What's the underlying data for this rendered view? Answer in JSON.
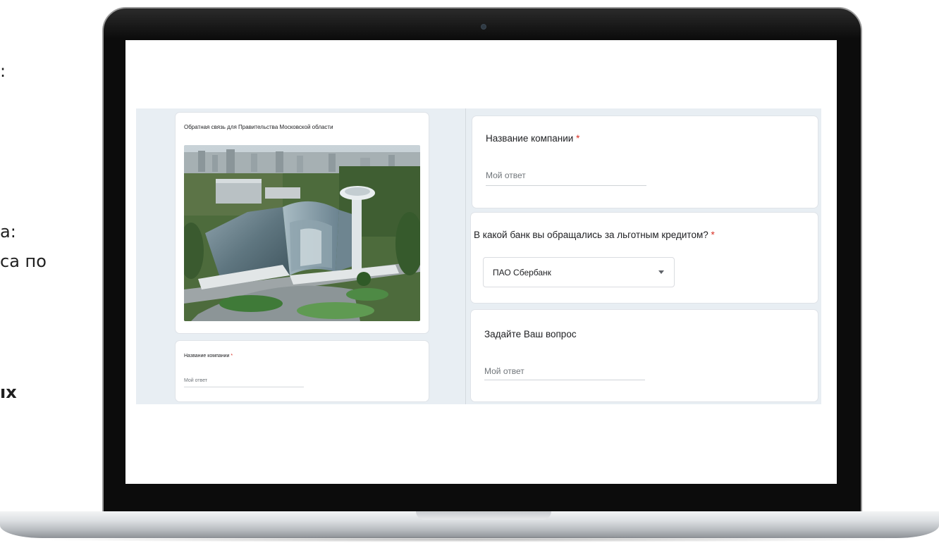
{
  "background_fragments": [
    {
      "text": ":"
    },
    {
      "text": "а:"
    },
    {
      "text": "са по"
    },
    {
      "text": "ıх"
    }
  ],
  "left_card": {
    "title": "Обратная связь для Правительства Московской области"
  },
  "left_question": {
    "label": "Название компании",
    "required_mark": "*",
    "answer_placeholder": "Мой ответ"
  },
  "questions": [
    {
      "label": "Название компании",
      "required_mark": "*",
      "placeholder": "Мой ответ"
    },
    {
      "label": "В какой банк вы обращались за льготным кредитом?",
      "required_mark": "*",
      "selected": "ПАО Сбербанк"
    },
    {
      "label": "Задайте Ваш вопрос",
      "placeholder": "Мой ответ"
    }
  ],
  "colors": {
    "required": "#d93025",
    "band": "#e8eef3",
    "placeholder": "#70757a"
  }
}
